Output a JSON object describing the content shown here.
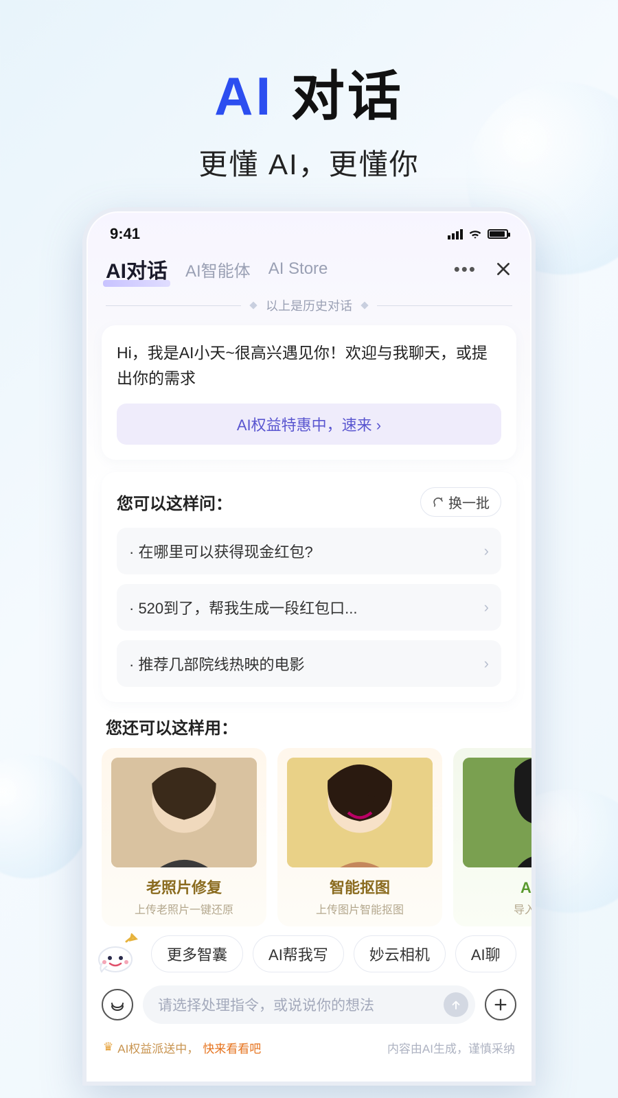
{
  "hero": {
    "title_ai": "AI",
    "title_rest": " 对话",
    "subtitle": "更懂 AI，更懂你"
  },
  "status": {
    "time": "9:41"
  },
  "tabs": {
    "items": [
      "AI对话",
      "AI智能体",
      "AI Store"
    ],
    "active_index": 0
  },
  "history_label": "以上是历史对话",
  "greeting": {
    "text": "Hi，我是AI小天~很高兴遇见你！欢迎与我聊天，或提出你的需求",
    "promo": "AI权益特惠中，速来 ›"
  },
  "ask": {
    "title": "您可以这样问：",
    "refresh": "换一批",
    "questions": [
      "·  在哪里可以获得现金红包?",
      "·  520到了，帮我生成一段红包口...",
      "·  推荐几部院线热映的电影"
    ]
  },
  "use": {
    "title": "您还可以这样用：",
    "cards": [
      {
        "name": "老照片修复",
        "desc": "上传老照片一键还原"
      },
      {
        "name": "智能抠图",
        "desc": "上传图片智能抠图"
      },
      {
        "name": "AI滤",
        "desc": "导入实拍"
      }
    ]
  },
  "chips": [
    "更多智囊",
    "AI帮我写",
    "妙云相机",
    "AI聊"
  ],
  "input": {
    "placeholder": "请选择处理指令，或说说你的想法"
  },
  "footer": {
    "left_prefix": "AI权益派送中，",
    "left_cta": "快来看看吧",
    "right": "内容由AI生成，谨慎采纳"
  }
}
